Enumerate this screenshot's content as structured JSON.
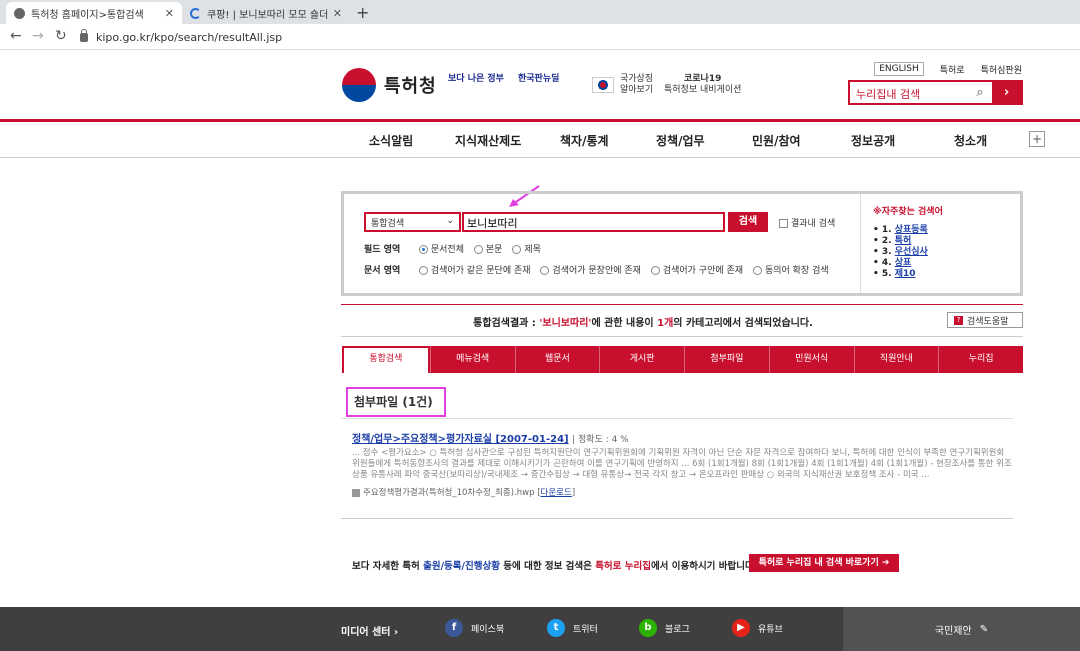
{
  "browser": {
    "tabs": [
      {
        "title": "특허청 홈페이지>통합검색",
        "active": true
      },
      {
        "title": "쿠팡! | 보니보따리 모모 숄더 크로",
        "active": false
      }
    ],
    "new_tab": "+",
    "url": "kipo.go.kr/kpo/search/resultAll.jsp"
  },
  "header": {
    "logo_text": "특허청",
    "banner_better_gov": "보다 나은 정부",
    "banner_new_deal": "한국판뉴딜",
    "banner_national_symbol_1": "국가상징",
    "banner_national_symbol_2": "알아보기",
    "banner_corona_1": "코로나19",
    "banner_corona_2": "특허정보 내비게이션",
    "links": [
      "ENGLISH",
      "특허로",
      "특허심판원"
    ],
    "search_placeholder": "누리집내 검색"
  },
  "gnb": [
    "소식알림",
    "지식재산제도",
    "책자/통계",
    "정책/업무",
    "민원/참여",
    "정보공개",
    "청소개"
  ],
  "search_panel": {
    "select_value": "통합검색",
    "query": "보니보따리",
    "search_button": "검색",
    "within_results": "결과내 검색",
    "field_label": "필드 영역",
    "field_options": [
      "문서전체",
      "본문",
      "제목"
    ],
    "doc_label": "문서 영역",
    "doc_options": [
      "검색어가 같은 문단에 존재",
      "검색어가 문장안에 존재",
      "검색어가 구안에 존재",
      "동의어 확장 검색"
    ],
    "popular_title": "※자주찾는 검색어",
    "popular": [
      {
        "rank": "1.",
        "term": "상표등록"
      },
      {
        "rank": "2.",
        "term": "특허"
      },
      {
        "rank": "3.",
        "term": "우선심사"
      },
      {
        "rank": "4.",
        "term": "상표"
      },
      {
        "rank": "5.",
        "term": "제10"
      }
    ]
  },
  "summary": {
    "prefix": "통합검색결과 : ",
    "query_quoted": "'보니보따리'",
    "middle": "에 관한 내용이 ",
    "count": "1개",
    "suffix": "의 카테고리에서 검색되었습니다.",
    "help_button": "검색도움말"
  },
  "result_tabs": [
    "통합검색",
    "메뉴검색",
    "웹문서",
    "게시판",
    "첨부파일",
    "민원서식",
    "직원안내",
    "누리집"
  ],
  "category_heading": "첨부파일 (1건)",
  "result": {
    "title": "정책/업무>주요정책>평가자료실 [2007-01-24]",
    "accuracy": "| 정확도 : 4 %",
    "snippet": "... 점수 <평가요소> ○ 특허청 심사관으로 구성된 특허지원단이 연구기획위원회에 기획위원 자격이 아닌 단순 자문 자격으로 참여하다 보니, 특허에 대한 인식이 부족한 연구기획위원회 위원들에게 특허동향조사의 결과를 제대로 이해시키기가 곤란하여 이를 연구기획에 반영하지 ... 6회 (1회1개월) 8회 (1회1개월) 4회 (1회1개월) 4회 (1회1개월) - 현장조사를 통한 위조상품 유통사례 파악 중국산(보따리상)/국내제조 → 중간수집상 → 대형 유통상→ 전국 각지 창고 → 온오프라인 판매상 ○ 외국의 지식재산권 보호정책 조사 - 미국 ...",
    "file": "주요정책평가결과(특허청_10차수정_최종).hwp",
    "download": "다운로드"
  },
  "bottom_note": {
    "part1": "보다 자세한 특허 ",
    "part2": "출원/등록/진행상황",
    "part3": " 등에 대한 정보 검색은 ",
    "part4": "특허로 누리집",
    "part5": "에서 이용하시기 바랍니다.",
    "button": "특허로 누리집 내 검색 바로가기 ➔"
  },
  "footer": {
    "media_center": "미디어 센터 ›",
    "social": [
      "페이스북",
      "트위터",
      "블로그",
      "유튜브"
    ],
    "proposal": "국민제안"
  },
  "colors": {
    "brand_red": "#c8102e",
    "link_blue": "#1a3ea8",
    "annotation_pink": "#e040e0"
  }
}
